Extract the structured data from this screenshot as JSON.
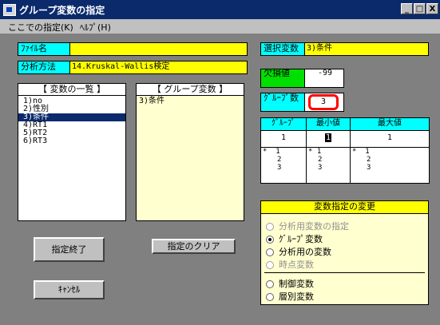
{
  "window": {
    "title": "グループ変数の指定",
    "controls": {
      "minimize": "_",
      "maximize": "□",
      "close": "X"
    }
  },
  "menu": [
    "ここでの指定(K)",
    "ﾍﾙﾌﾟ(H)"
  ],
  "file": {
    "label": "ﾌｧｲﾙ名",
    "value": ""
  },
  "method": {
    "label": "分析方法",
    "value": "14.Kruskal-Wallis検定"
  },
  "selected_var": {
    "label": "選択変数",
    "value": "3)条件"
  },
  "missing": {
    "label": "欠損値",
    "value": "-99"
  },
  "group_count": {
    "label": "ｸﾞﾙｰﾌﾟ数",
    "value": "3"
  },
  "var_list": {
    "header": "【 変数の一覧 】",
    "items": [
      "1)no",
      "2)性別",
      "3)条件",
      "4)RT1",
      "5)RT2",
      "6)RT3"
    ],
    "selected_index": 2
  },
  "group_vars": {
    "header": "【 グループ変数 】",
    "items": [
      "3)条件"
    ]
  },
  "group_grid": {
    "headers": [
      "ｸﾞﾙｰﾌﾟ",
      "最小値",
      "最大値"
    ],
    "row1": [
      "1",
      "1",
      "1"
    ],
    "row2": [
      [
        "*",
        "1",
        "2",
        "3"
      ],
      [
        "*",
        "1",
        "2",
        "3"
      ],
      [
        "*",
        "1",
        "2",
        "3"
      ]
    ]
  },
  "change_panel": {
    "title": "変数指定の変更",
    "options_top": [
      {
        "label": "分析用変数の指定",
        "enabled": false,
        "checked": false
      },
      {
        "label": "ｸﾞﾙｰﾌﾟ変数",
        "enabled": true,
        "checked": true
      },
      {
        "label": "分析用の変数",
        "enabled": true,
        "checked": false
      },
      {
        "label": "時点変数",
        "enabled": false,
        "checked": false
      }
    ],
    "options_bottom": [
      {
        "label": "制御変数",
        "enabled": true,
        "checked": false
      },
      {
        "label": "層別変数",
        "enabled": true,
        "checked": false
      }
    ]
  },
  "buttons": {
    "finish": "指定終了",
    "clear": "指定のクリア",
    "cancel": "ｷｬﾝｾﾙ"
  },
  "colors": {
    "title_bar": "#0a2a6b",
    "label_bg": "#00ffff",
    "value_bg": "#ffff00",
    "missing_label_bg": "#00e000",
    "panel_bg": "#ffffd0",
    "highlight_ring": "#ff0000"
  }
}
